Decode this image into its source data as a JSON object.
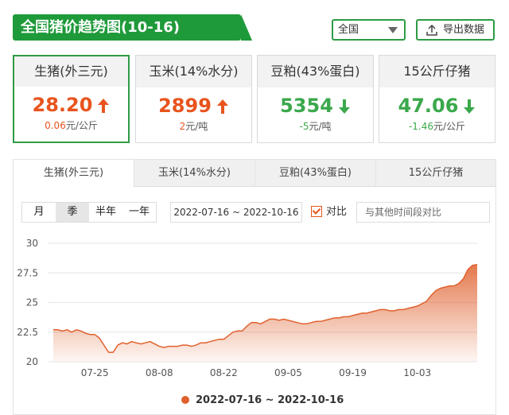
{
  "header": {
    "title": "全国猪价趋势图(10-16)"
  },
  "region_select": {
    "value": "全国"
  },
  "export_button": {
    "label": "导出数据"
  },
  "cards": [
    {
      "name": "生猪(外三元)",
      "value": "28.20",
      "change": "0.06",
      "unit": "元/公斤",
      "direction": "up",
      "active": true
    },
    {
      "name": "玉米(14%水分)",
      "value": "2899",
      "change": "2",
      "unit": "元/吨",
      "direction": "up",
      "active": false
    },
    {
      "name": "豆粕(43%蛋白)",
      "value": "5354",
      "change": "-5",
      "unit": "元/吨",
      "direction": "down",
      "active": false
    },
    {
      "name": "15公斤仔猪",
      "value": "47.06",
      "change": "-1.46",
      "unit": "元/公斤",
      "direction": "down",
      "active": false
    }
  ],
  "tabs": [
    "生猪(外三元)",
    "玉米(14%水分)",
    "豆粕(43%蛋白)",
    "15公斤仔猪"
  ],
  "period_buttons": [
    "月",
    "季",
    "半年",
    "一年"
  ],
  "selected_period": "季",
  "date_range": "2022-07-16 ~ 2022-10-16",
  "compare": {
    "label": "对比",
    "placeholder": "与其他时间段对比"
  },
  "colors": {
    "green": "#1f9a3a",
    "up": "#e8541e",
    "down": "#3aa84b",
    "series": "#e0612e"
  },
  "chart_data": {
    "type": "area",
    "ylim": [
      20,
      30
    ],
    "yticks": [
      20,
      22.5,
      25,
      27.5,
      30
    ],
    "xticks": [
      "07-25",
      "08-08",
      "08-22",
      "09-05",
      "09-19",
      "10-03"
    ],
    "grid": true,
    "legend": "bottom",
    "series": [
      {
        "name": "2022-07-16 ~ 2022-10-16",
        "x": [
          "07-16",
          "07-17",
          "07-18",
          "07-19",
          "07-20",
          "07-21",
          "07-22",
          "07-23",
          "07-24",
          "07-25",
          "07-26",
          "07-27",
          "07-28",
          "07-29",
          "07-30",
          "07-31",
          "08-01",
          "08-02",
          "08-03",
          "08-04",
          "08-05",
          "08-06",
          "08-07",
          "08-08",
          "08-09",
          "08-10",
          "08-11",
          "08-12",
          "08-13",
          "08-14",
          "08-15",
          "08-16",
          "08-17",
          "08-18",
          "08-19",
          "08-20",
          "08-21",
          "08-22",
          "08-23",
          "08-24",
          "08-25",
          "08-26",
          "08-27",
          "08-28",
          "08-29",
          "08-30",
          "08-31",
          "09-01",
          "09-02",
          "09-03",
          "09-04",
          "09-05",
          "09-06",
          "09-07",
          "09-08",
          "09-09",
          "09-10",
          "09-11",
          "09-12",
          "09-13",
          "09-14",
          "09-15",
          "09-16",
          "09-17",
          "09-18",
          "09-19",
          "09-20",
          "09-21",
          "09-22",
          "09-23",
          "09-24",
          "09-25",
          "09-26",
          "09-27",
          "09-28",
          "09-29",
          "09-30",
          "10-01",
          "10-02",
          "10-03",
          "10-04",
          "10-05",
          "10-06",
          "10-07",
          "10-08",
          "10-09",
          "10-10",
          "10-11",
          "10-12",
          "10-13",
          "10-14",
          "10-15",
          "10-16"
        ],
        "y": [
          22.7,
          22.7,
          22.6,
          22.7,
          22.5,
          22.7,
          22.6,
          22.4,
          22.3,
          22.3,
          22.0,
          21.4,
          20.8,
          20.8,
          21.4,
          21.6,
          21.5,
          21.7,
          21.6,
          21.5,
          21.6,
          21.7,
          21.5,
          21.3,
          21.2,
          21.3,
          21.3,
          21.3,
          21.4,
          21.4,
          21.3,
          21.4,
          21.6,
          21.6,
          21.7,
          21.8,
          21.9,
          21.9,
          22.2,
          22.5,
          22.6,
          22.6,
          23.0,
          23.3,
          23.3,
          23.2,
          23.4,
          23.6,
          23.6,
          23.5,
          23.6,
          23.5,
          23.4,
          23.3,
          23.2,
          23.2,
          23.3,
          23.4,
          23.4,
          23.5,
          23.6,
          23.7,
          23.7,
          23.8,
          23.8,
          23.9,
          24.0,
          24.1,
          24.1,
          24.2,
          24.3,
          24.4,
          24.4,
          24.3,
          24.3,
          24.4,
          24.4,
          24.5,
          24.6,
          24.7,
          24.9,
          25.1,
          25.6,
          26.0,
          26.2,
          26.3,
          26.4,
          26.4,
          26.6,
          27.0,
          27.8,
          28.14,
          28.2
        ]
      }
    ]
  }
}
